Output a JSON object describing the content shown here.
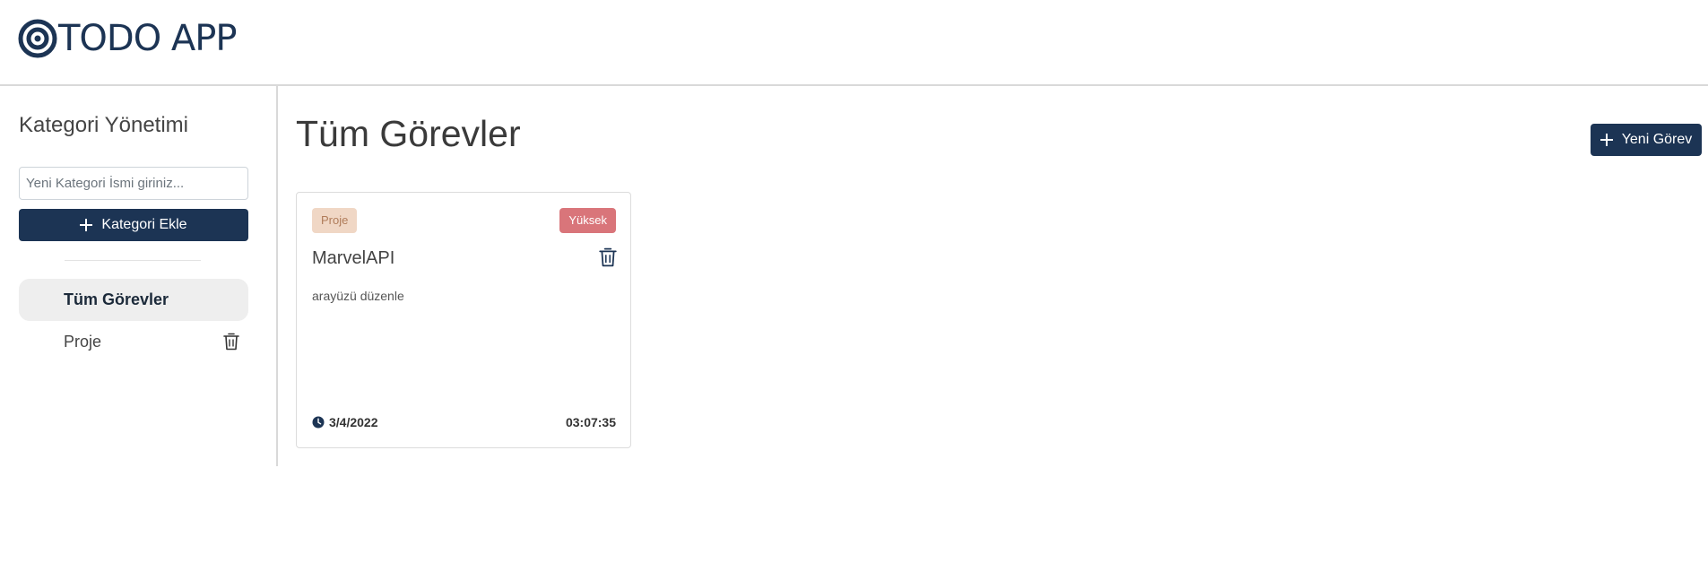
{
  "app": {
    "logo_text": "TODO APP",
    "logo_icon": "target-icon"
  },
  "sidebar": {
    "title": "Kategori Yönetimi",
    "input_placeholder": "Yeni Kategori İsmi giriniz...",
    "input_value": "",
    "add_button_label": "Kategori Ekle",
    "items": [
      {
        "label": "Tüm Görevler",
        "active": true
      },
      {
        "label": "Proje",
        "active": false,
        "deletable": true
      }
    ]
  },
  "main": {
    "title": "Tüm Görevler",
    "new_task_label": "Yeni Görev",
    "tasks": [
      {
        "category": "Proje",
        "priority": "Yüksek",
        "title": "MarvelAPI",
        "description": "arayüzü düzenle",
        "date": "3/4/2022",
        "time": "03:07:35"
      }
    ]
  },
  "colors": {
    "brand": "#1c3454",
    "category_badge_bg": "#f0d7c5",
    "category_badge_text": "#b07c5a",
    "priority_high_bg": "#d9757a",
    "active_nav_bg": "#eeeeee"
  }
}
